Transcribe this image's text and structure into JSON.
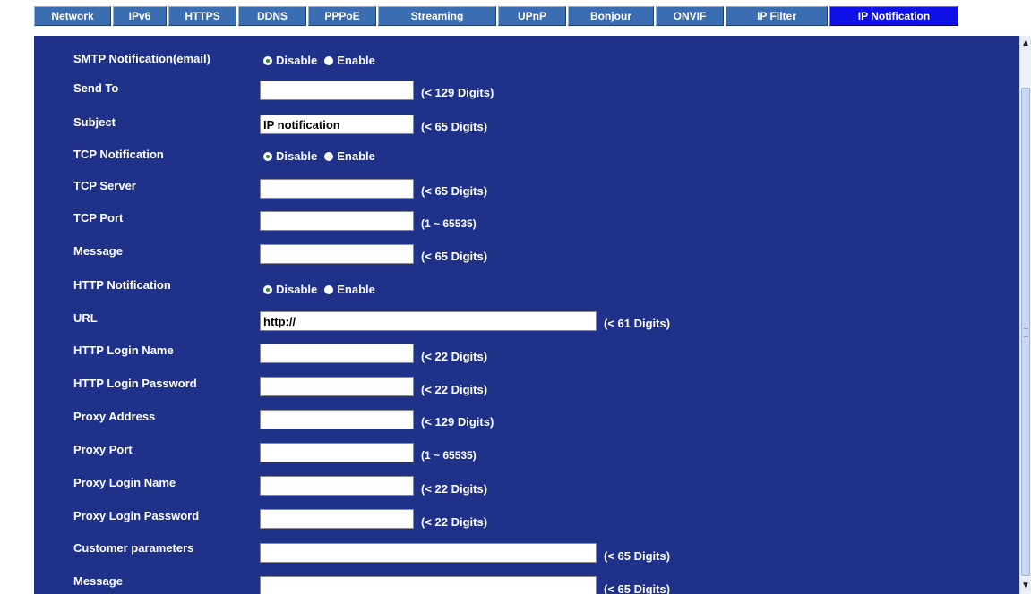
{
  "tabs": [
    {
      "label": "Network"
    },
    {
      "label": "IPv6"
    },
    {
      "label": "HTTPS"
    },
    {
      "label": "DDNS"
    },
    {
      "label": "PPPoE"
    },
    {
      "label": "Streaming"
    },
    {
      "label": "UPnP"
    },
    {
      "label": "Bonjour"
    },
    {
      "label": "ONVIF"
    },
    {
      "label": "IP Filter"
    },
    {
      "label": "IP Notification"
    }
  ],
  "active_tab": "IP Notification",
  "radio": {
    "disable": "Disable",
    "enable": "Enable"
  },
  "form": {
    "smtp_notification": {
      "label": "SMTP Notification(email)",
      "selected": "Disable"
    },
    "send_to": {
      "label": "Send To",
      "value": "",
      "hint": "(< 129 Digits)"
    },
    "subject": {
      "label": "Subject",
      "value": "IP notification",
      "hint": "(< 65 Digits)"
    },
    "tcp_notification": {
      "label": "TCP Notification",
      "selected": "Disable"
    },
    "tcp_server": {
      "label": "TCP Server",
      "value": "",
      "hint": "(< 65 Digits)"
    },
    "tcp_port": {
      "label": "TCP Port",
      "value": "",
      "hint": "(1 ~ 65535)"
    },
    "tcp_message": {
      "label": "Message",
      "value": "",
      "hint": "(< 65 Digits)"
    },
    "http_notification": {
      "label": "HTTP Notification",
      "selected": "Disable"
    },
    "url": {
      "label": "URL",
      "value": "http://",
      "hint": "(< 61 Digits)"
    },
    "http_login_name": {
      "label": "HTTP Login Name",
      "value": "",
      "hint": "(< 22 Digits)"
    },
    "http_login_password": {
      "label": "HTTP Login Password",
      "value": "",
      "hint": "(< 22 Digits)"
    },
    "proxy_address": {
      "label": "Proxy Address",
      "value": "",
      "hint": "(< 129 Digits)"
    },
    "proxy_port": {
      "label": "Proxy Port",
      "value": "",
      "hint": "(1 ~ 65535)"
    },
    "proxy_login_name": {
      "label": "Proxy Login Name",
      "value": "",
      "hint": "(< 22 Digits)"
    },
    "proxy_login_password": {
      "label": "Proxy Login Password",
      "value": "",
      "hint": "(< 22 Digits)"
    },
    "customer_parameters": {
      "label": "Customer parameters",
      "value": "",
      "hint": "(< 65 Digits)"
    },
    "http_message": {
      "label": "Message",
      "value": "",
      "hint": "(< 65 Digits)"
    }
  },
  "icons": {
    "scroll_up": "chevron-up-icon",
    "scroll_down": "chevron-down-icon"
  },
  "colors": {
    "panel_bg": "#1f3189",
    "tab_bg": "#3b6db2",
    "active_tab_bg": "#1010e8",
    "text": "#ffffff"
  }
}
